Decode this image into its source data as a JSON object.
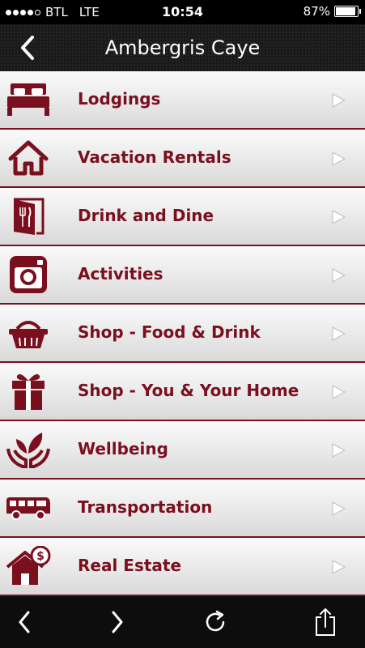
{
  "status": {
    "carrier": "BTL",
    "network": "LTE",
    "time": "10:54",
    "battery": "87%",
    "battery_level": 0.87,
    "signal_bars": 4
  },
  "header": {
    "title": "Ambergris Caye"
  },
  "items": [
    {
      "label": "Lodgings",
      "icon": "bed-icon"
    },
    {
      "label": "Vacation Rentals",
      "icon": "house-icon"
    },
    {
      "label": "Drink and Dine",
      "icon": "door-fork-knife-icon"
    },
    {
      "label": "Activities",
      "icon": "camera-icon"
    },
    {
      "label": "Shop - Food & Drink",
      "icon": "basket-icon"
    },
    {
      "label": "Shop - You & Your Home",
      "icon": "gift-icon"
    },
    {
      "label": "Wellbeing",
      "icon": "hands-leaf-icon"
    },
    {
      "label": "Transportation",
      "icon": "bus-icon"
    },
    {
      "label": "Real Estate",
      "icon": "house-dollar-icon"
    }
  ],
  "colors": {
    "accent": "#7a0f1e",
    "nav_bg": "#1a1a1a"
  }
}
